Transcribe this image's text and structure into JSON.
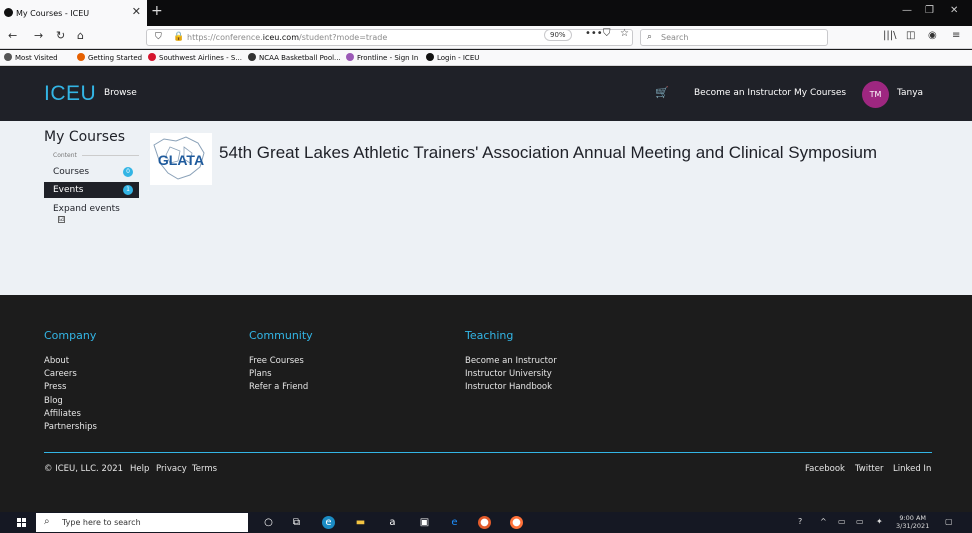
{
  "browser": {
    "tab_title": "My Courses - ICEU",
    "new_tab": "+",
    "url_prefix": "https://conference.",
    "url_domain": "iceu.com",
    "url_path": "/student?mode=trade",
    "zoom": "90%",
    "search_placeholder": "Search"
  },
  "bookmarks": [
    {
      "label": "Most Visited",
      "color": "#555555"
    },
    {
      "label": "Getting Started",
      "color": "#e66000"
    },
    {
      "label": "Southwest Airlines - S...",
      "color": "#d5152e"
    },
    {
      "label": "NCAA Basketball Pool...",
      "color": "#333333"
    },
    {
      "label": "Frontline - Sign In",
      "color": "#9b59b6"
    },
    {
      "label": "Login - ICEU",
      "color": "#111111"
    }
  ],
  "header": {
    "logo": "ICEU",
    "browse": "Browse",
    "become_instructor": "Become an Instructor",
    "my_courses": "My Courses",
    "avatar_initials": "TM",
    "user_name": "Tanya"
  },
  "sidebar": {
    "title": "My Courses",
    "content_label": "Content",
    "items": [
      {
        "label": "Courses",
        "count": "0"
      },
      {
        "label": "Events",
        "count": "1"
      }
    ],
    "expand_label": "Expand events",
    "expand_checked": "☑"
  },
  "course": {
    "logo_text": "GLATA",
    "title": "54th Great Lakes Athletic Trainers' Association Annual Meeting and Clinical Symposium"
  },
  "footer": {
    "columns": [
      {
        "heading": "Company",
        "links": [
          "About",
          "Careers",
          "Press",
          "Blog",
          "Affiliates",
          "Partnerships"
        ]
      },
      {
        "heading": "Community",
        "links": [
          "Free Courses",
          "Plans",
          "Refer a Friend"
        ]
      },
      {
        "heading": "Teaching",
        "links": [
          "Become an Instructor",
          "Instructor University",
          "Instructor Handbook"
        ]
      }
    ],
    "copyright": "© ICEU, LLC. 2021",
    "bottom_links": [
      "Help",
      "Privacy",
      "Terms"
    ],
    "social": [
      "Facebook",
      "Twitter",
      "Linked In"
    ]
  },
  "taskbar": {
    "search_placeholder": "Type here to search",
    "time": "9:00 AM",
    "date": "3/31/2021"
  },
  "colors": {
    "accent": "#33b5e5",
    "header_bg": "#1f2128",
    "avatar": "#9e2780",
    "footer_bg": "#1c1c1c",
    "main_bg": "#edf1f5"
  }
}
